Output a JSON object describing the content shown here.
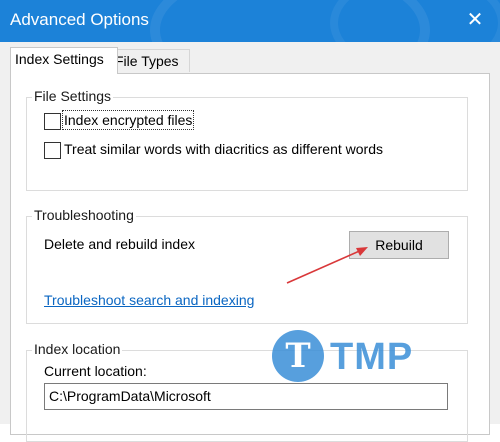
{
  "window": {
    "title": "Advanced Options",
    "close_glyph": "✕"
  },
  "tabs": [
    {
      "label": "Index Settings",
      "active": true
    },
    {
      "label": "File Types",
      "active": false
    }
  ],
  "file_settings": {
    "label": "File Settings",
    "options": [
      {
        "label": "Index encrypted files",
        "checked": false
      },
      {
        "label": "Treat similar words with diacritics as different words",
        "checked": false
      }
    ]
  },
  "troubleshooting": {
    "label": "Troubleshooting",
    "delete_rebuild_text": "Delete and rebuild index",
    "rebuild_button": "Rebuild",
    "link_text": "Troubleshoot search and indexing"
  },
  "index_location": {
    "label": "Index location",
    "current_label": "Current location:",
    "current_value": "C:\\ProgramData\\Microsoft"
  },
  "watermark": {
    "letter": "T",
    "text": "TMP"
  },
  "colors": {
    "titlebar": "#1c82d8",
    "annotation_arrow": "#d9383a",
    "link": "#0a66c2"
  }
}
